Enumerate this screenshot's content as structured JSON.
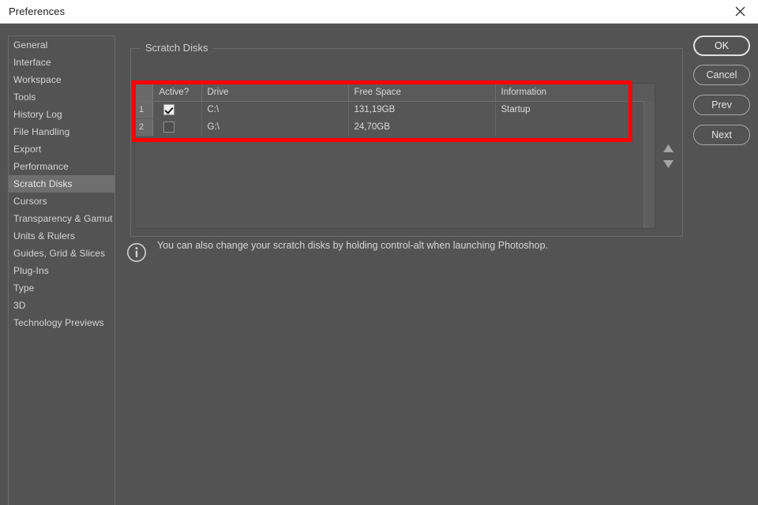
{
  "window": {
    "title": "Preferences",
    "close_icon": "close-icon"
  },
  "sidebar": {
    "items": [
      {
        "label": "General",
        "selected": false
      },
      {
        "label": "Interface",
        "selected": false
      },
      {
        "label": "Workspace",
        "selected": false
      },
      {
        "label": "Tools",
        "selected": false
      },
      {
        "label": "History Log",
        "selected": false
      },
      {
        "label": "File Handling",
        "selected": false
      },
      {
        "label": "Export",
        "selected": false
      },
      {
        "label": "Performance",
        "selected": false
      },
      {
        "label": "Scratch Disks",
        "selected": true
      },
      {
        "label": "Cursors",
        "selected": false
      },
      {
        "label": "Transparency & Gamut",
        "selected": false
      },
      {
        "label": "Units & Rulers",
        "selected": false
      },
      {
        "label": "Guides, Grid & Slices",
        "selected": false
      },
      {
        "label": "Plug-Ins",
        "selected": false
      },
      {
        "label": "Type",
        "selected": false
      },
      {
        "label": "3D",
        "selected": false
      },
      {
        "label": "Technology Previews",
        "selected": false
      }
    ]
  },
  "main": {
    "group_title": "Scratch Disks",
    "table": {
      "headers": {
        "num": "",
        "active": "Active?",
        "drive": "Drive",
        "free_space": "Free Space",
        "information": "Information"
      },
      "rows": [
        {
          "num": "1",
          "active": true,
          "drive": "C:\\",
          "free_space": "131,19GB",
          "information": "Startup"
        },
        {
          "num": "2",
          "active": false,
          "drive": "G:\\",
          "free_space": "24,70GB",
          "information": ""
        }
      ]
    },
    "nudge_up_icon": "triangle-up-icon",
    "nudge_down_icon": "triangle-down-icon",
    "hint": {
      "icon": "info-circle-icon",
      "text": "You can also change your scratch disks by holding control-alt when launching Photoshop."
    }
  },
  "buttons": {
    "ok": "OK",
    "cancel": "Cancel",
    "prev": "Prev",
    "next": "Next"
  },
  "annotation": {
    "color": "#ff0000"
  }
}
